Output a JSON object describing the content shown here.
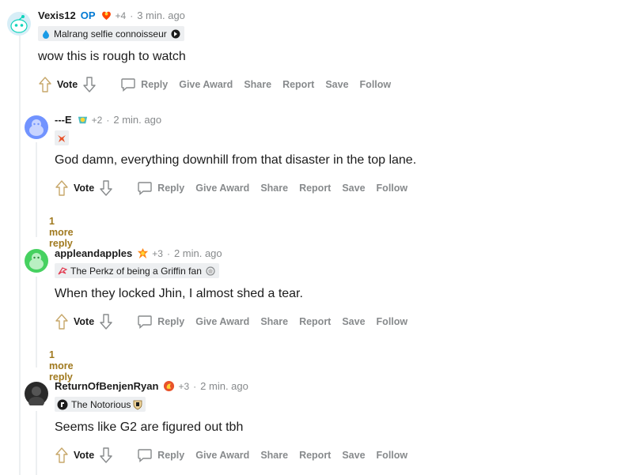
{
  "comments": [
    {
      "author": "Vexis12",
      "op": "OP",
      "karma": "+4",
      "dot": "·",
      "time": "3 min. ago",
      "flair": "Malrang selfie connoisseur",
      "body": "wow this is rough to watch",
      "avatar_color": "#0dd3bb"
    },
    {
      "author": "---E",
      "karma": "+2",
      "dot": "·",
      "time": "2 min. ago",
      "body": "God damn, everything downhill from that disaster in the top lane.",
      "avatar_color": "#7193ff"
    },
    {
      "author": "appleandapples",
      "karma": "+3",
      "dot": "·",
      "time": "2 min. ago",
      "flair": "The Perkz of being a Griffin fan",
      "body": "When they locked Jhin, I almost shed a tear.",
      "avatar_color": "#46d160"
    },
    {
      "author": "ReturnOfBenjenRyan",
      "karma": "+3",
      "dot": "·",
      "time": "2 min. ago",
      "flair": "The Notorious",
      "body": "Seems like G2 are figured out tbh",
      "avatar_color": "#2a2a2a"
    }
  ],
  "actions": {
    "vote": "Vote",
    "reply": "Reply",
    "give_award": "Give Award",
    "share": "Share",
    "report": "Report",
    "save": "Save",
    "follow": "Follow"
  },
  "more_replies": [
    "1 more reply",
    "1 more reply"
  ],
  "colors": {
    "link_gold": "#a0791e",
    "meta_gray": "#878a8c",
    "op_blue": "#0079d3"
  }
}
